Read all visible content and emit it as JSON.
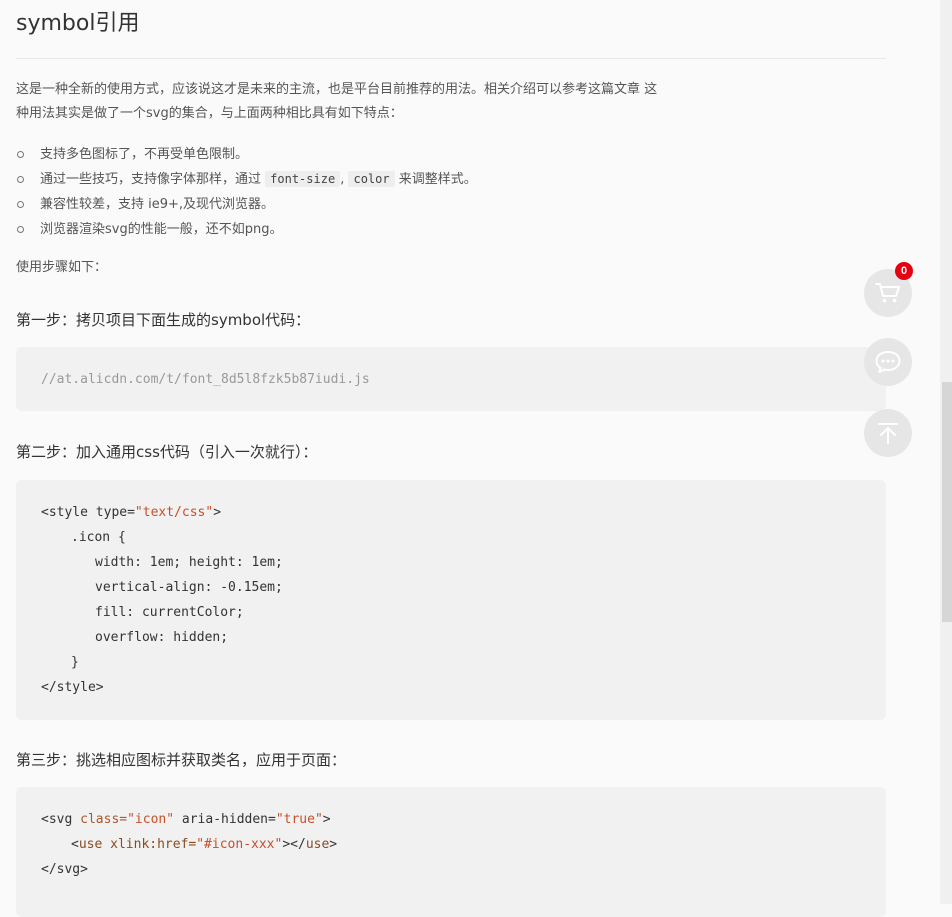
{
  "page": {
    "title": "symbol引用",
    "intro_line1": "这是一种全新的使用方式，应该说这才是未来的主流，也是平台目前推荐的用法。相关介绍可以参考这篇文章 这",
    "intro_line2": "种用法其实是做了一个svg的集合，与上面两种相比具有如下特点："
  },
  "features": {
    "item1": "支持多色图标了，不再受单色限制。",
    "item2_pre": "通过一些技巧，支持像字体那样，通过",
    "item2_code1": "font-size",
    "item2_sep": ",",
    "item2_code2": "color",
    "item2_post": "来调整样式。",
    "item3": "兼容性较差，支持 ie9+,及现代浏览器。",
    "item4": "浏览器渲染svg的性能一般，还不如png。"
  },
  "usage_label": "使用步骤如下：",
  "step1": {
    "title": "第一步：拷贝项目下面生成的symbol代码：",
    "code": "//at.alicdn.com/t/font_8d5l8fzk5b87iudi.js"
  },
  "step2": {
    "title": "第二步：加入通用css代码（引入一次就行）：",
    "l1_open": "<style type=",
    "l1_val": "\"text/css\"",
    "l1_close": ">",
    "l2": ".icon {",
    "l3": "width: 1em; height: 1em;",
    "l4": "vertical-align: -0.15em;",
    "l5": "fill: currentColor;",
    "l6": "overflow: hidden;",
    "l7": "}",
    "l8": "</style>"
  },
  "step3": {
    "title": "第三步：挑选相应图标并获取类名，应用于页面：",
    "l1_tag": "<svg ",
    "l1_attr1": "class=",
    "l1_val1": "\"icon\"",
    "l1_attr2": " aria-hidden=",
    "l1_val2": "\"true\"",
    "l1_close": ">",
    "l2_open": "<",
    "l2_tag": "use",
    "l2_attr": " xlink:href=",
    "l2_val": "\"#icon-xxx\"",
    "l2_mid": "></",
    "l2_tag2": "use",
    "l2_close": ">",
    "l3": "</svg>"
  },
  "floating": {
    "cart_icon": "cart-icon",
    "cart_count": "0",
    "chat_icon": "chat-icon",
    "top_icon": "back-to-top-icon",
    "badge_color": "#e60012"
  }
}
